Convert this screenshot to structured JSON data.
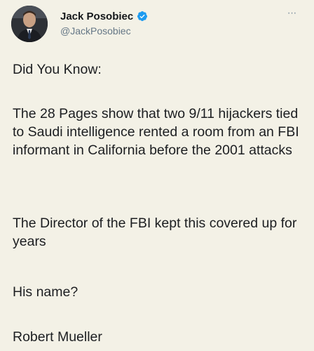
{
  "author": {
    "display_name": "Jack Posobiec",
    "handle": "@JackPosobiec",
    "verified": true,
    "avatar_icon": "avatar-photo",
    "verified_icon": "verified-badge-icon",
    "verified_color": "#1d9bf0"
  },
  "menu": {
    "more_icon": "more-options-icon",
    "more_label": "···"
  },
  "tweet": {
    "paragraphs": [
      "Did You Know:",
      "The 28 Pages show that two 9/11 hijackers tied to Saudi intelligence rented a room from an FBI informant in California before the 2001 attacks",
      "The Director of the FBI kept this covered up for years",
      "His name?",
      "Robert Mueller"
    ]
  },
  "colors": {
    "background": "#f3f1e6",
    "text": "#1c1e21",
    "secondary_text": "#657786"
  }
}
